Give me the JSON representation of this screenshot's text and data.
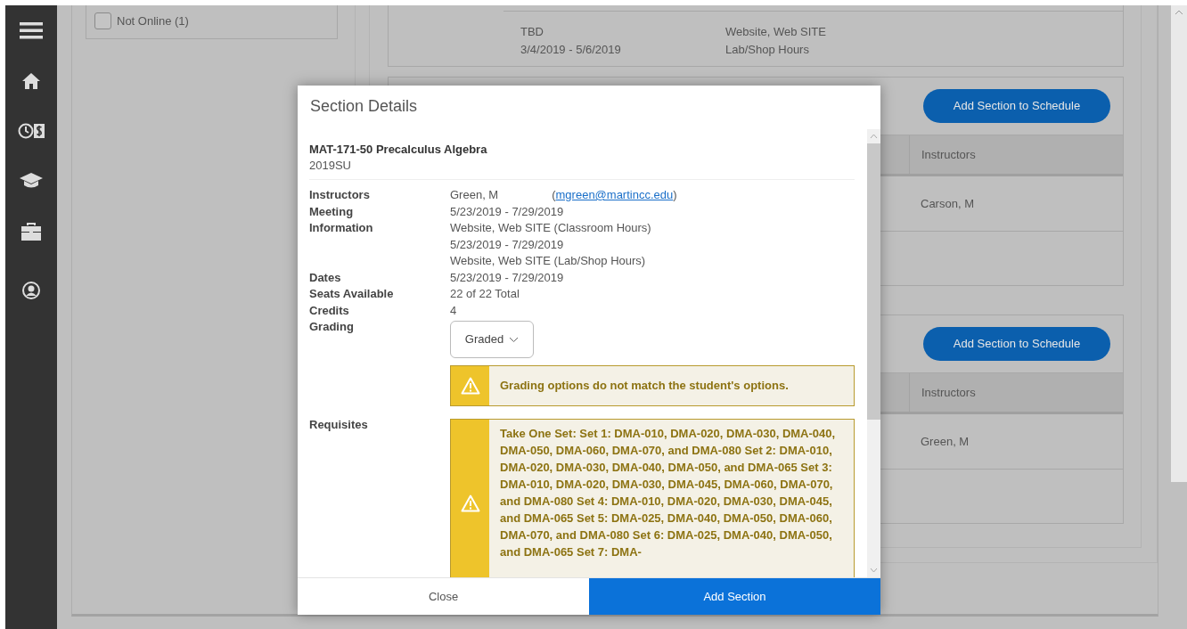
{
  "filters": [
    {
      "label": "Not Online (1)",
      "checked": false
    }
  ],
  "meeting_card": {
    "column_1": [
      "TBD",
      "3/4/2019 - 5/6/2019"
    ],
    "column_2": [
      "Website, Web SITE",
      "Lab/Shop Hours"
    ]
  },
  "sections": [
    {
      "button": "Add Section to Schedule",
      "header": "Instructors",
      "instructor": "Carson, M"
    },
    {
      "button": "Add Section to Schedule",
      "header": "Instructors",
      "instructor": "Green, M"
    }
  ],
  "modal": {
    "title": "Section Details",
    "course": "MAT-171-50 Precalculus Algebra",
    "term": "2019SU",
    "details": [
      {
        "kind": "instructor",
        "label": "Instructors",
        "name": "Green, M",
        "paren_open": "(",
        "email": "mgreen@martincc.edu",
        "paren_close": ")"
      },
      {
        "kind": "text",
        "label": "Meeting Information",
        "values": [
          "5/23/2019 - 7/29/2019",
          "Website, Web SITE (Classroom Hours)",
          "5/23/2019 - 7/29/2019",
          "Website, Web SITE (Lab/Shop Hours)"
        ]
      },
      {
        "kind": "text",
        "label": "Dates",
        "values": [
          "5/23/2019 - 7/29/2019"
        ]
      },
      {
        "kind": "text",
        "label": "Seats Available",
        "values": [
          "22 of 22 Total"
        ]
      },
      {
        "kind": "text",
        "label": "Credits",
        "values": [
          "4"
        ]
      },
      {
        "kind": "select",
        "label": "Grading",
        "value": "Graded",
        "warning": "Grading options do not match the student's options."
      },
      {
        "kind": "alert",
        "label": "Requisites",
        "warning": "Take One Set: Set 1: DMA-010, DMA-020, DMA-030, DMA-040, DMA-050, DMA-060, DMA-070, and DMA-080 Set 2: DMA-010, DMA-020, DMA-030, DMA-040, DMA-050, and DMA-065 Set 3: DMA-010, DMA-020, DMA-030, DMA-045, DMA-060, DMA-070, and DMA-080 Set 4: DMA-010, DMA-020, DMA-030, DMA-045, and DMA-065 Set 5: DMA-025, DMA-040, DMA-050, DMA-060, DMA-070, and DMA-080 Set 6: DMA-025, DMA-040, DMA-050, and DMA-065 Set 7: DMA-"
      }
    ],
    "buttons": [
      {
        "label": "Close",
        "kind": "secondary"
      },
      {
        "label": "Add Section",
        "kind": "primary"
      }
    ]
  }
}
